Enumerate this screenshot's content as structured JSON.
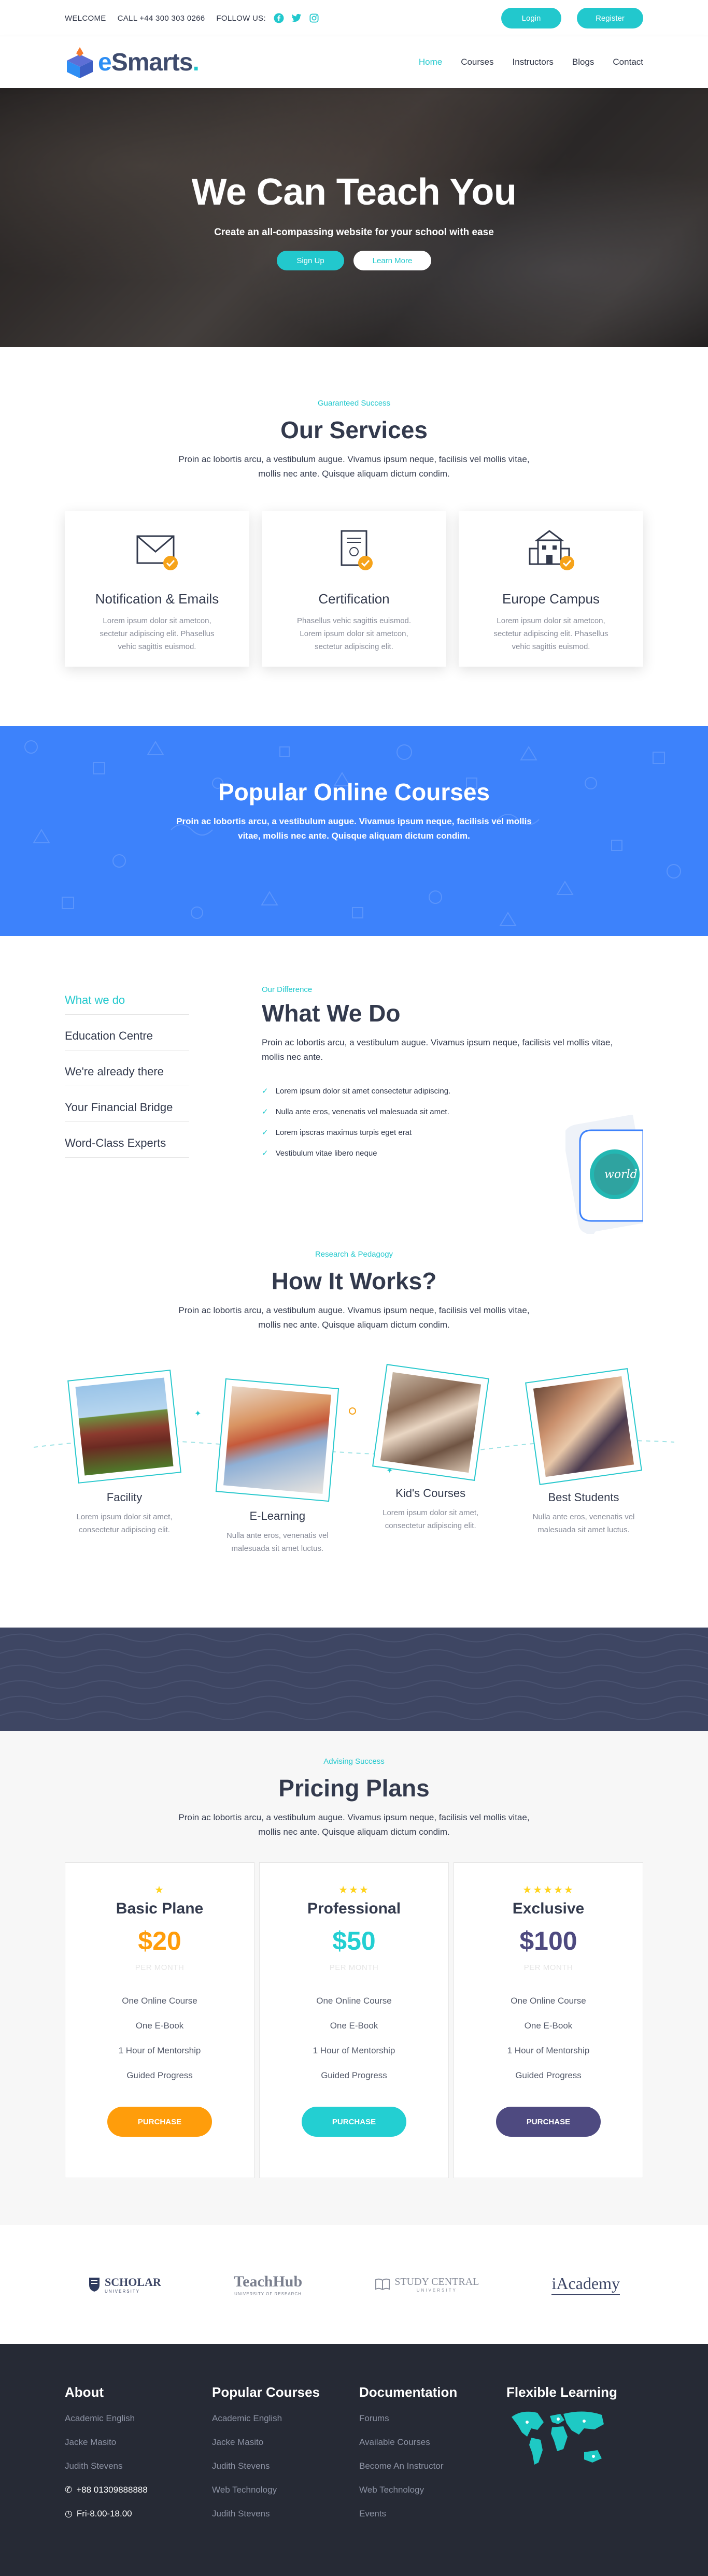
{
  "topbar": {
    "welcome": "WELCOME",
    "call": "CALL +44 300 303 0266",
    "follow": "FOLLOW US:",
    "social_icons": [
      "facebook-icon",
      "twitter-icon",
      "instagram-icon"
    ],
    "login": "Login",
    "register": "Register"
  },
  "brand": {
    "name_e": "e",
    "name_rest": "Smarts",
    "dot": "."
  },
  "nav": {
    "home": "Home",
    "courses": "Courses",
    "instructors": "Instructors",
    "blogs": "Blogs",
    "contact": "Contact"
  },
  "hero": {
    "title": "We Can Teach You",
    "subtitle": "Create an all-compassing website for your school with ease",
    "signup": "Sign Up",
    "learn": "Learn More"
  },
  "services": {
    "eyebrow": "Guaranteed Success",
    "title": "Our Services",
    "lead": "Proin ac lobortis arcu, a vestibulum augue. Vivamus ipsum neque, facilisis vel mollis vitae, mollis nec ante. Quisque aliquam dictum condim.",
    "cards": [
      {
        "icon": "envelope-icon",
        "title": "Notification & Emails",
        "text": "Lorem ipsum dolor sit ametcon, sectetur adipiscing elit. Phasellus vehic sagittis euismod."
      },
      {
        "icon": "certificate-icon",
        "title": "Certification",
        "text": "Phasellus vehic sagittis euismod. Lorem ipsum dolor sit ametcon, sectetur adipiscing elit."
      },
      {
        "icon": "campus-building-icon",
        "title": "Europe Campus",
        "text": "Lorem ipsum dolor sit ametcon, sectetur adipiscing elit. Phasellus vehic sagittis euismod."
      }
    ]
  },
  "popular": {
    "title": "Popular Online Courses",
    "lead": "Proin ac lobortis arcu, a vestibulum augue. Vivamus ipsum neque, facilisis vel mollis vitae, mollis nec ante. Quisque aliquam dictum condim."
  },
  "whatwedo": {
    "tabs": [
      "What we do",
      "Education Centre",
      "We're already there",
      "Your Financial Bridge",
      "Word-Class Experts"
    ],
    "eyebrow": "Our Difference",
    "title": "What We Do",
    "lead": "Proin ac lobortis arcu, a vestibulum augue. Vivamus ipsum neque, facilisis vel mollis vitae, mollis nec ante.",
    "list": [
      "Lorem ipsum dolor sit amet consectetur adipiscing.",
      "Nulla ante eros, venenatis vel malesuada sit amet.",
      "Lorem ipscras maximus turpis eget erat",
      "Vestibulum vitae libero neque"
    ],
    "bubble_text": "world"
  },
  "how": {
    "eyebrow": "Research & Pedagogy",
    "title": "How It Works?",
    "lead": "Proin ac lobortis arcu, a vestibulum augue. Vivamus ipsum neque, facilisis vel mollis vitae, mollis nec ante. Quisque aliquam dictum condim.",
    "items": [
      {
        "title": "Facility",
        "text": "Lorem ipsum dolor sit amet, consectetur adipiscing elit."
      },
      {
        "title": "E-Learning",
        "text": "Nulla ante eros, venenatis vel malesuada sit amet luctus."
      },
      {
        "title": "Kid's Courses",
        "text": "Lorem ipsum dolor sit amet, consectetur adipiscing elit."
      },
      {
        "title": "Best Students",
        "text": "Nulla ante eros, venenatis vel malesuada sit amet luctus."
      }
    ]
  },
  "pricing": {
    "eyebrow": "Advising Success",
    "title": "Pricing Plans",
    "lead": "Proin ac lobortis arcu, a vestibulum augue. Vivamus ipsum neque, facilisis vel mollis vitae, mollis nec ante. Quisque aliquam dictum condim.",
    "plans": [
      {
        "stars": "★",
        "name": "Basic Plane",
        "price": "$20",
        "per": "PER MONTH",
        "color": "#ff9d0b",
        "features": [
          "One Online Course",
          "One E-Book",
          "1 Hour of Mentorship",
          "Guided Progress"
        ],
        "button": "PURCHASE"
      },
      {
        "stars": "★★★",
        "name": "Professional",
        "price": "$50",
        "per": "PER MONTH",
        "color": "#23cfd2",
        "features": [
          "One Online Course",
          "One E-Book",
          "1 Hour of Mentorship",
          "Guided Progress"
        ],
        "button": "PURCHASE"
      },
      {
        "stars": "★★★★★",
        "name": "Exclusive",
        "price": "$100",
        "per": "PER MONTH",
        "color": "#4e4a80",
        "features": [
          "One Online Course",
          "One E-Book",
          "1 Hour of Mentorship",
          "Guided Progress"
        ],
        "button": "PURCHASE"
      }
    ]
  },
  "partners": {
    "scholar": "SCHOLAR",
    "scholar_sub": "UNIVERSITY",
    "teachhub": "TeachHub",
    "teachhub_sub": "UNIVERSITY OF RESEARCH",
    "study": "STUDY CENTRAL",
    "study_sub": "UNIVERSITY",
    "iacademy": "iAcademy"
  },
  "footer": {
    "about": {
      "title": "About",
      "links": [
        "Academic English",
        "Jacke Masito",
        "Judith Stevens"
      ],
      "phone": "+88 01309888888",
      "hours": "Fri-8.00-18.00"
    },
    "popular": {
      "title": "Popular Courses",
      "links": [
        "Academic English",
        "Jacke Masito",
        "Judith Stevens",
        "Web Technology",
        "Judith Stevens"
      ]
    },
    "docs": {
      "title": "Documentation",
      "links": [
        "Forums",
        "Available Courses",
        "Become An Instructor",
        "Web Technology",
        "Events"
      ]
    },
    "flex": {
      "title": "Flexible Learning"
    }
  },
  "colors": {
    "accent": "#22c8cd",
    "blue": "#3d82fb",
    "navy": "#3e4663",
    "footer": "#262a35"
  }
}
